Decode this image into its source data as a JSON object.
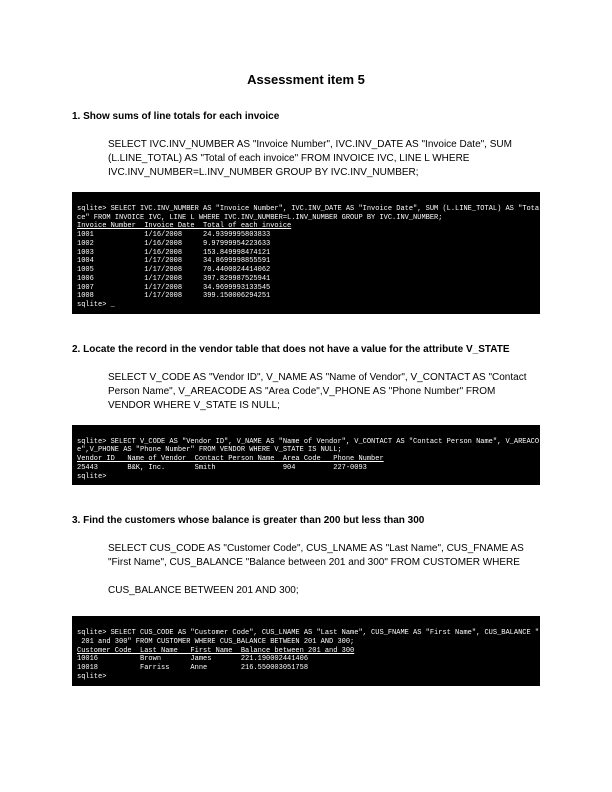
{
  "title": "Assessment item 5",
  "q1": {
    "head": "1. Show sums of line totals for each invoice",
    "sql": "SELECT IVC.INV_NUMBER AS \"Invoice Number\", IVC.INV_DATE AS \"Invoice Date\", SUM (L.LINE_TOTAL) AS \"Total of each invoice\" FROM INVOICE IVC, LINE L WHERE IVC.INV_NUMBER=L.INV_NUMBER GROUP BY IVC.INV_NUMBER;",
    "shot_line1": "sqlite> SELECT IVC.INV_NUMBER AS \"Invoice Number\", IVC.INV_DATE AS \"Invoice Date\", SUM (L.LINE_TOTAL) AS \"Total of each invoi",
    "shot_line2": "ce\" FROM INVOICE IVC, LINE L WHERE IVC.INV_NUMBER=L.INV_NUMBER GROUP BY IVC.INV_NUMBER;",
    "shot_header": "Invoice Number  Invoice Date  Total of each invoice",
    "shot_sep": "--------------- ------------- ---------------------",
    "rows": [
      "1001            1/16/2008     24.9399995803833",
      "1002            1/16/2008     9.97999954223633",
      "1003            1/16/2008     153.849998474121",
      "1004            1/17/2008     34.8699998855591",
      "1005            1/17/2008     70.4400024414062",
      "1006            1/17/2008     397.829987525941",
      "1007            1/17/2008     34.9699993133545",
      "1008            1/17/2008     399.150006294251"
    ],
    "prompt": "sqlite> _"
  },
  "q2": {
    "head": "2. Locate the record in the vendor table that does not have a value for the attribute V_STATE",
    "sql": "SELECT V_CODE AS \"Vendor ID\", V_NAME AS \"Name of Vendor\", V_CONTACT AS \"Contact Person Name\", V_AREACODE AS \"Area Code\",V_PHONE AS \"Phone Number\" FROM VENDOR WHERE V_STATE IS NULL;",
    "shot_line1": "sqlite> SELECT V_CODE AS \"Vendor ID\", V_NAME AS \"Name of Vendor\", V_CONTACT AS \"Contact Person Name\", V_AREACODE AS \"Area Cod",
    "shot_line2": "e\",V_PHONE AS \"Phone Number\" FROM VENDOR WHERE V_STATE IS NULL;",
    "shot_header": "Vendor ID   Name of Vendor  Contact Person Name  Area Code   Phone Number",
    "shot_sep": "----------  --------------  -------------------  ----------  ------------",
    "row": "25443       B&K, Inc.       Smith                904         227-0093",
    "prompt": "sqlite>"
  },
  "q3": {
    "head": "3. Find the customers whose balance is greater than 200 but less than 300",
    "sql_l1": "SELECT CUS_CODE AS \"Customer Code\", CUS_LNAME AS \"Last Name\", CUS_FNAME AS \"First Name\", CUS_BALANCE \"Balance between 201 and 300\" FROM CUSTOMER WHERE",
    "sql_l2": "CUS_BALANCE BETWEEN 201 AND 300;",
    "shot_line1": "sqlite> SELECT CUS_CODE AS \"Customer Code\", CUS_LNAME AS \"Last Name\", CUS_FNAME AS \"First Name\", CUS_BALANCE \"Balance between",
    "shot_line2": " 201 and 300\" FROM CUSTOMER WHERE CUS_BALANCE BETWEEN 201 AND 300;",
    "shot_header": "Customer Code  Last Name   First Name  Balance between 201 and 300",
    "shot_sep": "-------------  ----------  ----------  ---------------------------",
    "rows": [
      "10016          Brown       James       221.190002441406",
      "10018          Farriss     Anne        216.550003051758"
    ],
    "prompt": "sqlite>"
  }
}
